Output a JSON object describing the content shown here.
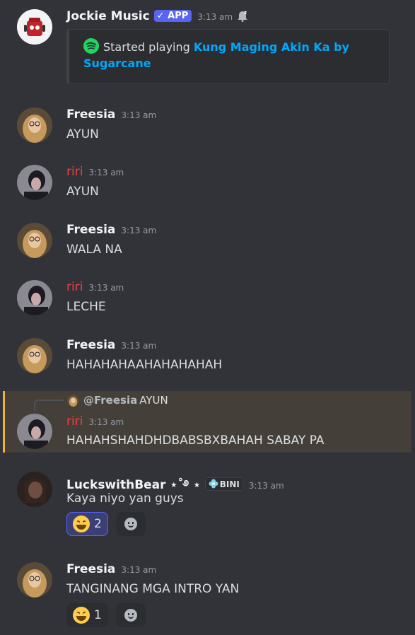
{
  "colors": {
    "background": "#313338",
    "app_badge": "#5865f2",
    "link": "#00a8fc",
    "riri_name": "#f23f43",
    "highlight_bar": "#f0b232",
    "reaction_active_border": "#5865f2"
  },
  "messages": [
    {
      "author": "Jockie Music",
      "badge": "✓ APP",
      "time": "3:13 am",
      "icons": [
        "bell-snooze-icon"
      ],
      "embed": {
        "icon": "spotify-icon",
        "prefix": "Started playing ",
        "link": "Kung Maging Akin Ka by Sugarcane"
      }
    },
    {
      "author": "Freesia",
      "time": "3:13 am",
      "text": "AYUN"
    },
    {
      "author": "riri",
      "time": "3:13 am",
      "text": "AYUN"
    },
    {
      "author": "Freesia",
      "time": "3:13 am",
      "text": "WALA NA"
    },
    {
      "author": "riri",
      "time": "3:13 am",
      "text": "LECHE"
    },
    {
      "author": "Freesia",
      "time": "3:13 am",
      "text": "HAHAHAHAAHAHAHAHAH"
    },
    {
      "author": "riri",
      "time": "3:13 am",
      "text": "HAHAHSHAHDHDBABSBXBAHAH SABAY PA",
      "reply": {
        "mention": "@Freesia",
        "text": "AYUN"
      }
    },
    {
      "author": "LuckswithBear ⋆˚࿔ ⋆",
      "role_badge": "BINI",
      "time": "3:13 am",
      "text": "Kaya niyo yan guys",
      "reactions": [
        {
          "emoji": "laughing-emoji",
          "count": "2",
          "active": true
        }
      ]
    },
    {
      "author": "Freesia",
      "time": "3:13 am",
      "text": "TANGINANG MGA INTRO YAN",
      "reactions": [
        {
          "emoji": "laughing-emoji",
          "count": "1",
          "active": false
        }
      ]
    }
  ]
}
